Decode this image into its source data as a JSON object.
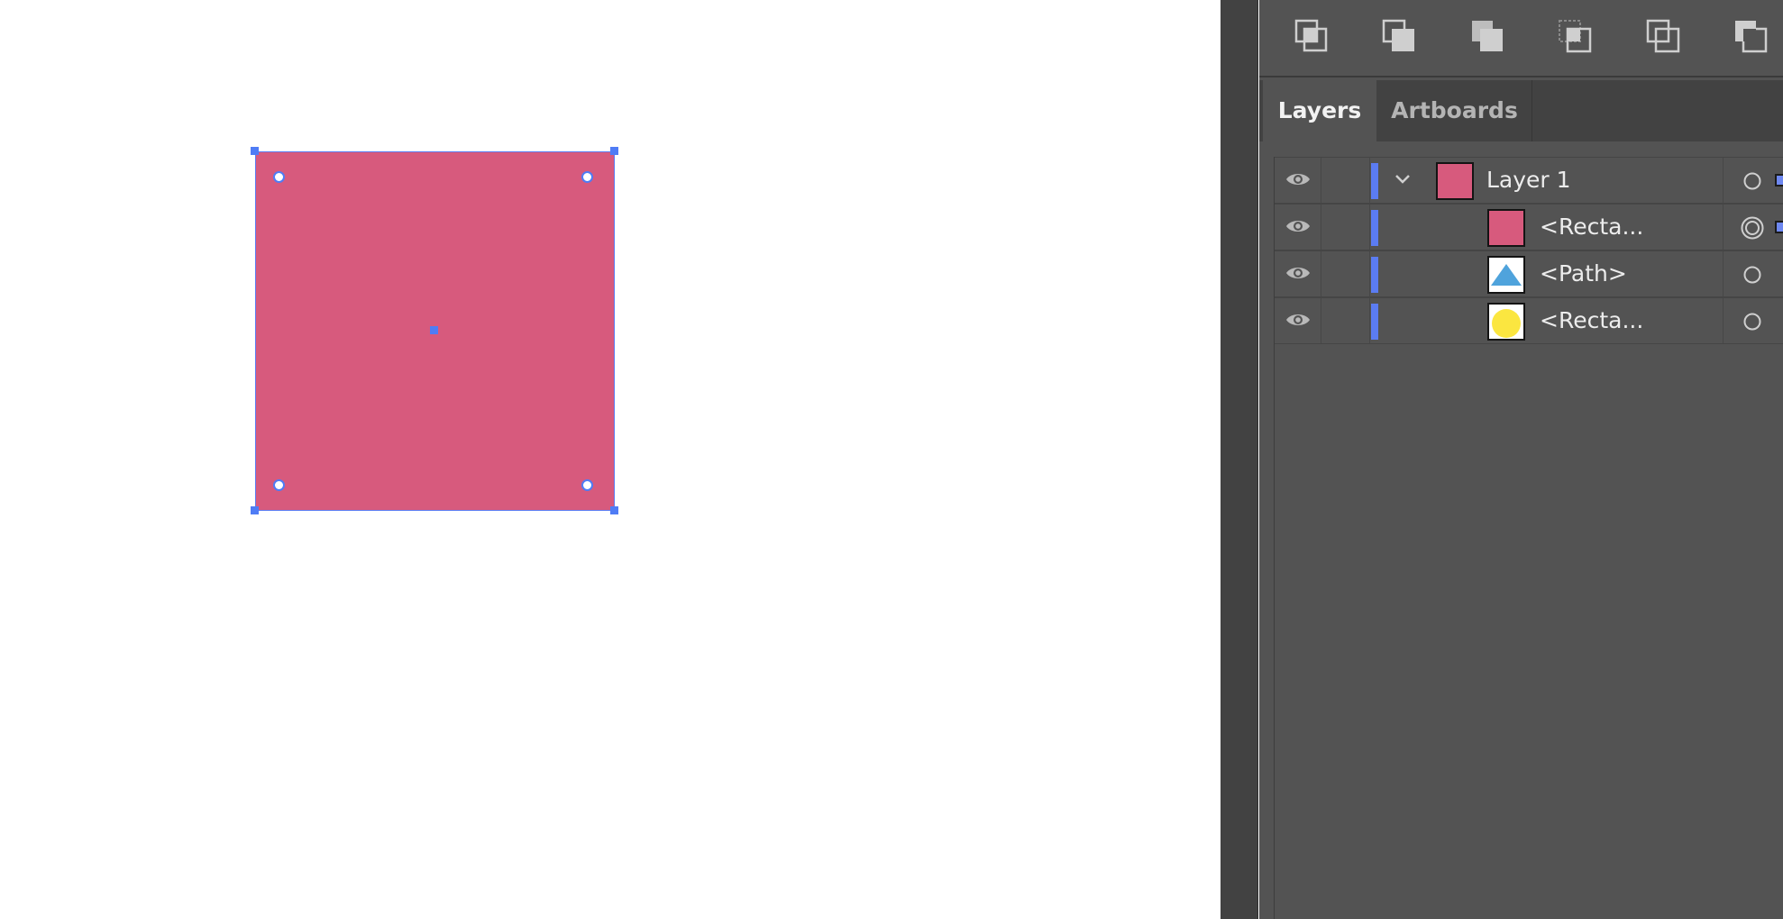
{
  "canvas": {
    "shape_fill": "#d75a7d",
    "selection_color": "#4f7cf5"
  },
  "pathfinder": {
    "buttons": [
      "pathfinder-divide-icon",
      "pathfinder-trim-icon",
      "pathfinder-merge-icon",
      "pathfinder-crop-icon",
      "pathfinder-outline-icon",
      "pathfinder-minus-back-icon"
    ]
  },
  "tabs": [
    {
      "label": "Layers",
      "active": true
    },
    {
      "label": "Artboards",
      "active": false
    }
  ],
  "layers": [
    {
      "name": "Layer 1",
      "thumb": "pink-square",
      "level": 0
    },
    {
      "name": "<Recta...",
      "thumb": "pink-square",
      "level": 1,
      "targeted": true
    },
    {
      "name": "<Path>",
      "thumb": "blue-triangle",
      "level": 1
    },
    {
      "name": "<Recta...",
      "thumb": "yellow-circle",
      "level": 1
    }
  ],
  "colors": {
    "layer_color": "#5b7cf2",
    "pink": "#d75a7d",
    "blue": "#4fa3dc",
    "yellow": "#fbe640"
  }
}
